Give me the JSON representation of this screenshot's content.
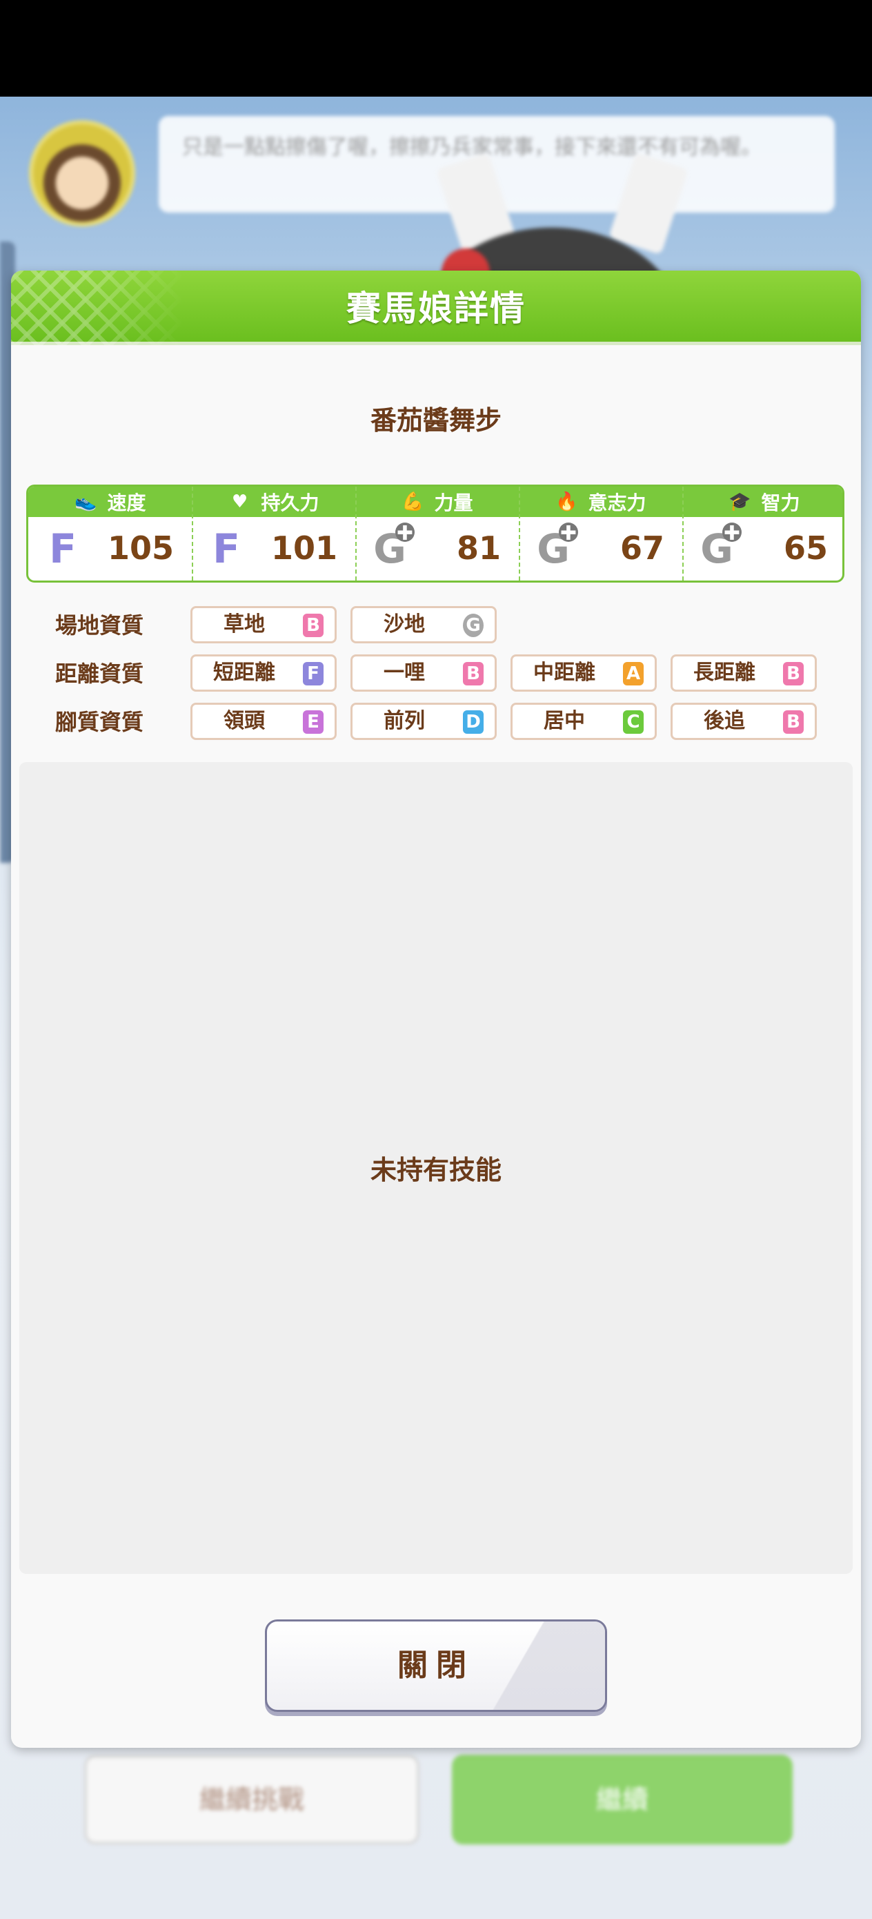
{
  "background": {
    "speech_text": "只是一點點擦傷了喔，擦擦乃兵家常事，接下來還不有可為喔。",
    "secondary_button_label": "繼續挑戰",
    "primary_button_label": "繼續"
  },
  "panel": {
    "title": "賽馬娘詳情",
    "horse_name": "番茄醬舞步",
    "stats": [
      {
        "label": "速度",
        "icon": "shoe-icon",
        "glyph": "👟",
        "rank": "F",
        "value": "105"
      },
      {
        "label": "持久力",
        "icon": "heart-icon",
        "glyph": "♥",
        "rank": "F",
        "value": "101"
      },
      {
        "label": "力量",
        "icon": "muscle-icon",
        "glyph": "💪",
        "rank": "G",
        "value": "81"
      },
      {
        "label": "意志力",
        "icon": "flame-icon",
        "glyph": "🔥",
        "rank": "G",
        "value": "67"
      },
      {
        "label": "智力",
        "icon": "graduation-cap-icon",
        "glyph": "🎓",
        "rank": "G",
        "value": "65"
      }
    ],
    "aptitudes": {
      "track": {
        "label": "場地資質",
        "items": [
          {
            "name": "草地",
            "rank": "B"
          },
          {
            "name": "沙地",
            "rank": "G"
          }
        ]
      },
      "distance": {
        "label": "距離資質",
        "items": [
          {
            "name": "短距離",
            "rank": "F"
          },
          {
            "name": "一哩",
            "rank": "B"
          },
          {
            "name": "中距離",
            "rank": "A"
          },
          {
            "name": "長距離",
            "rank": "B"
          }
        ]
      },
      "style": {
        "label": "腳質資質",
        "items": [
          {
            "name": "領頭",
            "rank": "E"
          },
          {
            "name": "前列",
            "rank": "D"
          },
          {
            "name": "居中",
            "rank": "C"
          },
          {
            "name": "後追",
            "rank": "B"
          }
        ]
      }
    },
    "skills_empty_text": "未持有技能",
    "close_label": "關閉"
  }
}
